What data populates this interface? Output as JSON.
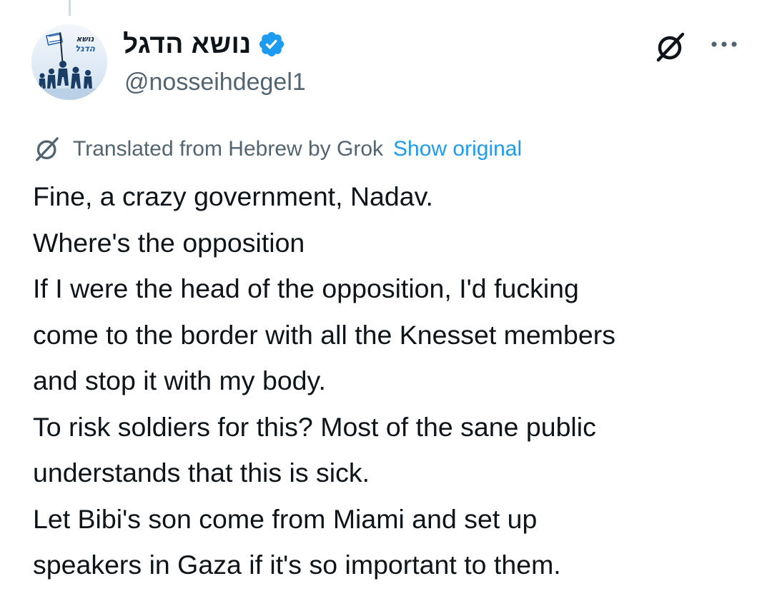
{
  "author": {
    "display_name": "נושא הדגל",
    "handle": "@nosseihdegel1",
    "verified": true,
    "avatar_logo_text": "נושא הדגל",
    "avatar_icon": "group-with-flag-avatar"
  },
  "actions": {
    "grok_icon": "grok-icon",
    "more_icon": "more-dots-icon"
  },
  "translation": {
    "icon": "grok-icon",
    "label": "Translated from Hebrew by Grok",
    "show_original": "Show original"
  },
  "tweet": {
    "lines": [
      "Fine, a crazy government, Nadav.",
      "Where's the opposition",
      "If I were the head of the opposition, I'd fucking",
      "come to the border with all the Knesset members",
      "and stop it with my body.",
      "To risk soldiers for this? Most of the sane public",
      "understands that this is sick.",
      "Let Bibi's son come from Miami and set up",
      "speakers in Gaza if it's so important to them."
    ]
  },
  "colors": {
    "text": "#0f1419",
    "secondary_text": "#536471",
    "link": "#1d9bf0",
    "verified": "#1d9bf0"
  }
}
